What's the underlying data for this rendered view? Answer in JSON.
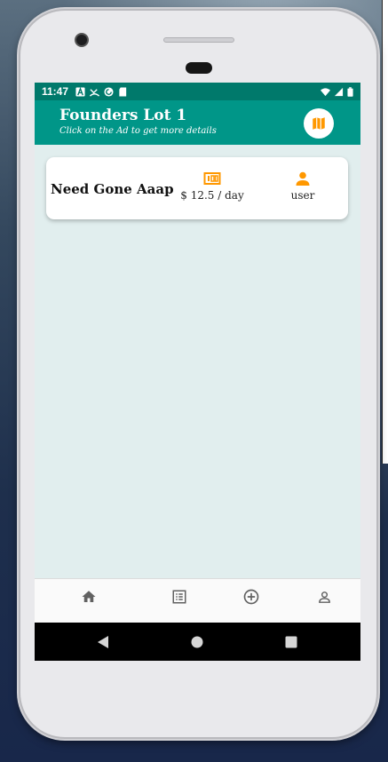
{
  "status_bar": {
    "time": "11:47",
    "left_icons": [
      "text-a-icon",
      "missed-call-icon",
      "pocket-casts-icon",
      "sd-card-icon"
    ],
    "right_icons": [
      "wifi-icon",
      "cell-signal-icon",
      "battery-icon"
    ]
  },
  "app_bar": {
    "title": "Founders Lot 1",
    "subtitle": "Click on the Ad to get more details",
    "map_icon": "map-icon"
  },
  "ad_card": {
    "title": "Need Gone Aaap",
    "price": "$ 12.5 / day",
    "price_icon": "money-icon",
    "user": "user",
    "user_icon": "person-icon"
  },
  "bottom_nav": {
    "items": [
      "home-icon",
      "list-icon",
      "add-circle-icon",
      "profile-icon"
    ]
  },
  "system_nav": {
    "buttons": [
      "back-icon",
      "home-circle-icon",
      "recents-icon"
    ]
  },
  "colors": {
    "app_bar": "#009688",
    "status_bar": "#00796b",
    "accent": "#ff9800",
    "background": "#e1eeee"
  }
}
